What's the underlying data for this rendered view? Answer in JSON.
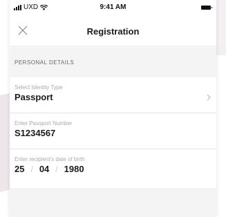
{
  "status_bar": {
    "carrier": "UXD",
    "time": "9:41 AM"
  },
  "nav": {
    "title": "Registration",
    "close_icon": "close-icon"
  },
  "section": {
    "header": "PERSONAL DETAILS"
  },
  "fields": {
    "identity_type": {
      "label": "Select Identity Type",
      "value": "Passport",
      "icon": "chevron-right-icon"
    },
    "passport_number": {
      "label": "Enter Passport Number",
      "value": "S1234567"
    },
    "date_of_birth": {
      "label": "Enter recipient's date of birth",
      "day": "25",
      "month": "04",
      "year": "1980",
      "separator": "/"
    }
  },
  "colors": {
    "background": "#f4f4f5",
    "text": "#1a1a1a",
    "label": "#a9a9ad",
    "divider": "#e2e2e4"
  }
}
